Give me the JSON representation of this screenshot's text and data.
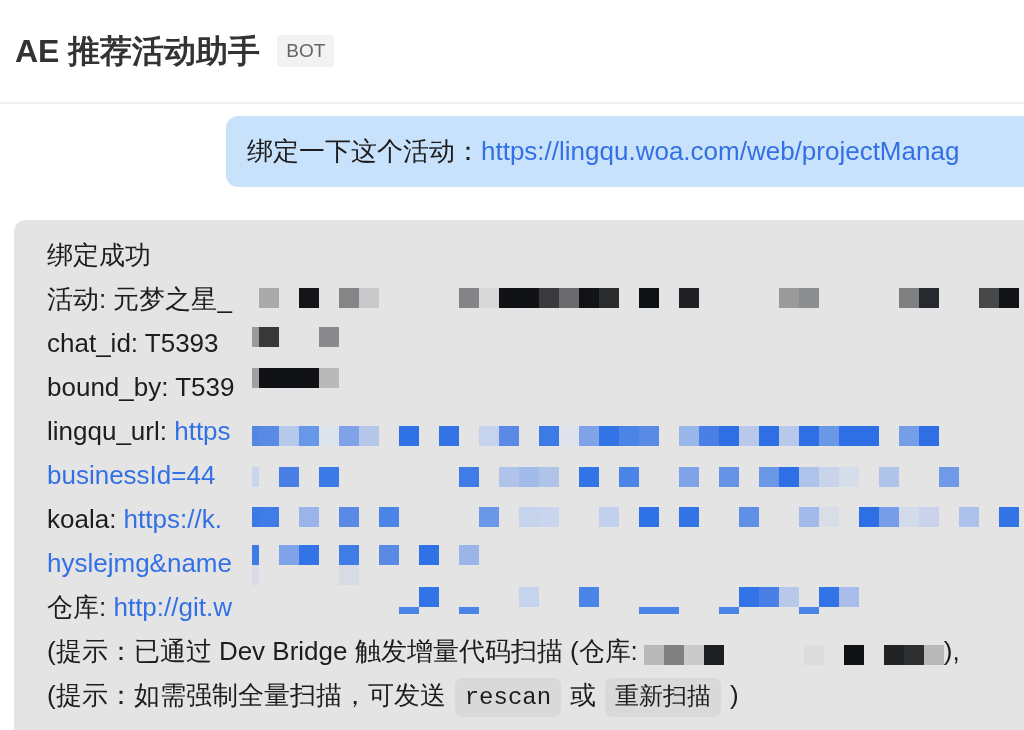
{
  "header": {
    "title": "AE 推荐活动助手",
    "badge": "BOT"
  },
  "messages": [
    {
      "kind": "user",
      "lines": [
        {
          "segments": [
            {
              "kind": "text",
              "text": "绑定一下这个活动："
            },
            {
              "kind": "link",
              "text": "https://lingqu.woa.com/web/projectManag"
            }
          ]
        }
      ]
    },
    {
      "kind": "bot",
      "lines": [
        {
          "segments": [
            {
              "kind": "text",
              "text": "绑定成功"
            }
          ]
        },
        {
          "segments": [
            {
              "kind": "text",
              "text": "活动: 元梦之星_"
            },
            {
              "kind": "redaction"
            }
          ]
        },
        {
          "segments": [
            {
              "kind": "text",
              "text": "chat_id: T5393"
            },
            {
              "kind": "redaction"
            }
          ]
        },
        {
          "segments": [
            {
              "kind": "text",
              "text": "bound_by: T539"
            },
            {
              "kind": "redaction"
            }
          ]
        },
        {
          "segments": [
            {
              "kind": "text",
              "text": "lingqu_url: "
            },
            {
              "kind": "link",
              "text": "https"
            },
            {
              "kind": "redaction"
            }
          ]
        },
        {
          "segments": [
            {
              "kind": "link",
              "text": "businessId=44"
            },
            {
              "kind": "redaction"
            }
          ]
        },
        {
          "segments": [
            {
              "kind": "text",
              "text": "koala: "
            },
            {
              "kind": "link",
              "text": "https://k."
            },
            {
              "kind": "redaction"
            }
          ]
        },
        {
          "segments": [
            {
              "kind": "link",
              "text": "hyslejmg&name"
            },
            {
              "kind": "redaction"
            }
          ]
        },
        {
          "segments": [
            {
              "kind": "text",
              "text": "仓库: "
            },
            {
              "kind": "link",
              "text": "http://git.w"
            },
            {
              "kind": "redaction"
            }
          ]
        },
        {
          "segments": [
            {
              "kind": "text",
              "text": "(提示：已通过 Dev Bridge 触发增量代码扫描 (仓库:"
            },
            {
              "kind": "redaction"
            },
            {
              "kind": "text",
              "text": "),"
            }
          ]
        },
        {
          "segments": [
            {
              "kind": "text",
              "text": "(提示：如需强制全量扫描，可发送"
            },
            {
              "kind": "code",
              "text": "rescan"
            },
            {
              "kind": "text",
              "text": "或"
            },
            {
              "kind": "code",
              "text": "重新扫描"
            },
            {
              "kind": "text",
              "text": ")"
            }
          ]
        }
      ]
    }
  ]
}
